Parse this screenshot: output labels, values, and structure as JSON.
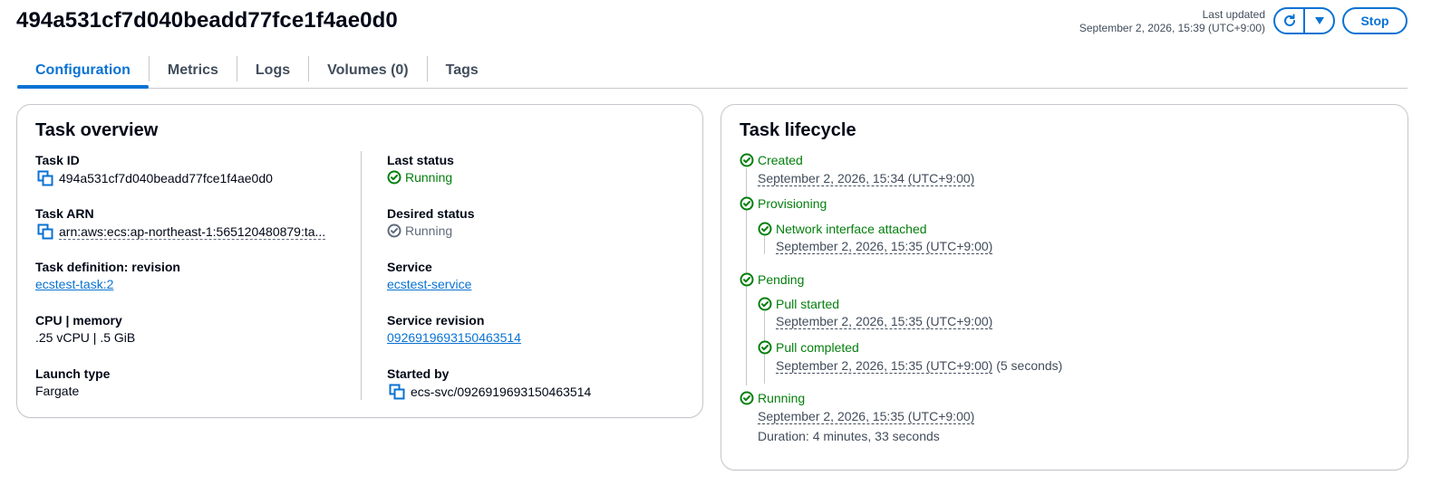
{
  "header": {
    "title": "494a531cf7d040beadd77fce1f4ae0d0",
    "last_updated_label": "Last updated",
    "last_updated_value": "September 2, 2026, 15:39 (UTC+9:00)",
    "stop_label": "Stop"
  },
  "tabs": [
    {
      "label": "Configuration",
      "active": true
    },
    {
      "label": "Metrics"
    },
    {
      "label": "Logs"
    },
    {
      "label": "Volumes (0)"
    },
    {
      "label": "Tags"
    }
  ],
  "overview": {
    "title": "Task overview",
    "task_id_label": "Task ID",
    "task_id_value": "494a531cf7d040beadd77fce1f4ae0d0",
    "task_arn_label": "Task ARN",
    "task_arn_value": "arn:aws:ecs:ap-northeast-1:565120480879:ta...",
    "task_def_label": "Task definition: revision",
    "task_def_value": "ecstest-task:2",
    "cpu_label": "CPU | memory",
    "cpu_value": ".25 vCPU | .5 GiB",
    "launch_label": "Launch type",
    "launch_value": "Fargate",
    "last_status_label": "Last status",
    "last_status_value": "Running",
    "desired_label": "Desired status",
    "desired_value": "Running",
    "service_label": "Service",
    "service_value": "ecstest-service",
    "service_rev_label": "Service revision",
    "service_rev_value": "0926919693150463514",
    "started_by_label": "Started by",
    "started_by_value": "ecs-svc/0926919693150463514"
  },
  "lifecycle": {
    "title": "Task lifecycle",
    "created": {
      "label": "Created",
      "time": "September 2, 2026, 15:34 (UTC+9:00)"
    },
    "provisioning": {
      "label": "Provisioning"
    },
    "network": {
      "label": "Network interface attached",
      "time": "September 2, 2026, 15:35 (UTC+9:00)"
    },
    "pending": {
      "label": "Pending"
    },
    "pull_started": {
      "label": "Pull started",
      "time": "September 2, 2026, 15:35 (UTC+9:00)"
    },
    "pull_completed": {
      "label": "Pull completed",
      "time": "September 2, 2026, 15:35 (UTC+9:00)",
      "extra": "(5 seconds)"
    },
    "running": {
      "label": "Running",
      "time": "September 2, 2026, 15:35 (UTC+9:00)",
      "duration": "Duration: 4 minutes, 33 seconds"
    }
  },
  "colors": {
    "accent": "#0972d3",
    "success": "#037f0c",
    "muted": "#5f6b7a",
    "border": "#c6c6cd"
  },
  "icons": {
    "copy": "copy-icon",
    "refresh": "refresh-icon",
    "caret": "caret-down-icon",
    "success": "status-success-icon",
    "stopped": "status-stopped-icon"
  }
}
